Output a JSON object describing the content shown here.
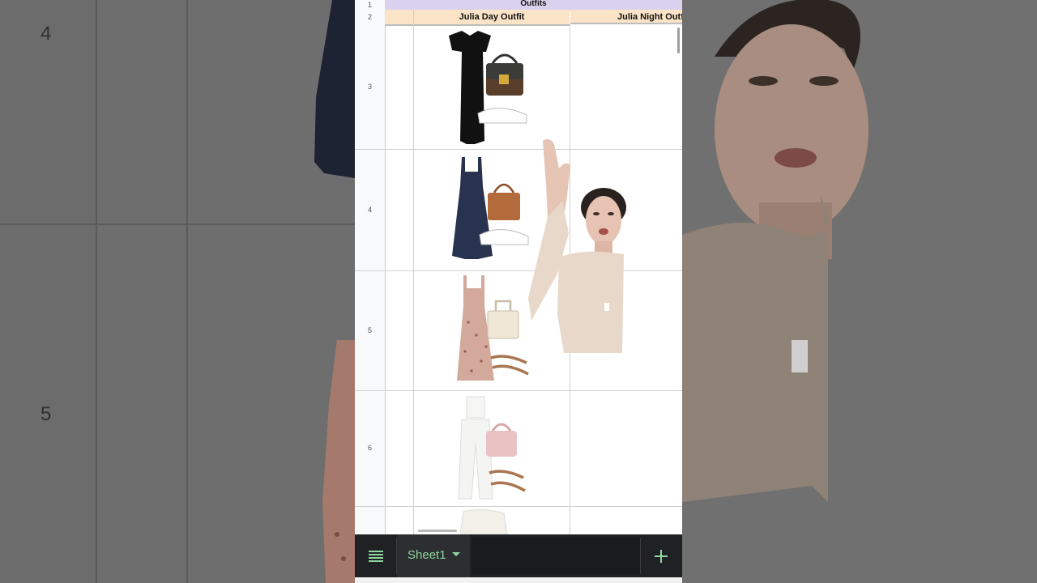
{
  "background": {
    "left_row_numbers": [
      "4",
      "5"
    ]
  },
  "sheet": {
    "title_row_text": "Outfits",
    "column_headers": [
      "Julia Day Outfit",
      "Julia Night Outfit"
    ],
    "row_numbers": [
      "1",
      "2",
      "3",
      "4",
      "5",
      "6"
    ],
    "outfits": [
      {
        "row": "3",
        "items": [
          "black-maxi-dress",
          "monogram-lock-bag",
          "white-sneakers"
        ]
      },
      {
        "row": "4",
        "items": [
          "navy-mini-dress",
          "tan-tote-bag",
          "white-sneakers"
        ]
      },
      {
        "row": "5",
        "items": [
          "floral-slip-dress",
          "cream-top-handle-bag",
          "tan-strappy-sandals"
        ]
      },
      {
        "row": "6",
        "items": [
          "white-wide-leg-set",
          "pink-top-handle-bag",
          "tan-strappy-sandals"
        ]
      }
    ],
    "header_colors": {
      "title_row": "#d9d2ee",
      "column_row": "#fbe3c8"
    }
  },
  "tabbar": {
    "sheet_tab_label": "Sheet1",
    "accent_color": "#8fd6a0",
    "menu_icon": "all-sheets-icon",
    "add_icon": "add-sheet-icon"
  }
}
